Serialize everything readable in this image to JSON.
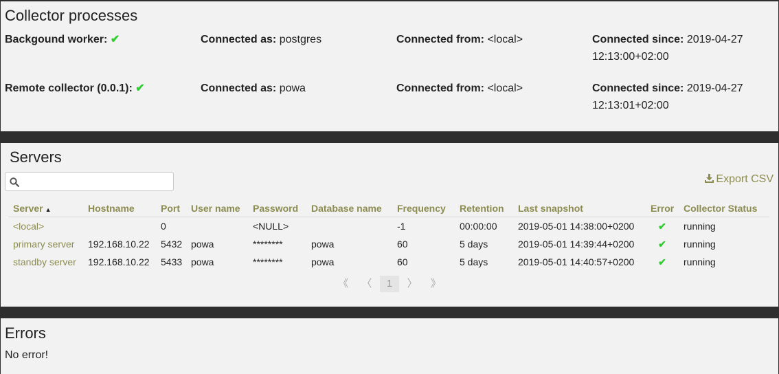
{
  "collector": {
    "title": "Collector processes",
    "rows": [
      {
        "name_label": "Backgound worker:",
        "connected_as_label": "Connected as:",
        "connected_as": "postgres",
        "connected_from_label": "Connected from:",
        "connected_from": "<local>",
        "connected_since_label": "Connected since:",
        "connected_since_date": "2019-04-27",
        "connected_since_time": "12:13:00+02:00"
      },
      {
        "name_label": "Remote collector (0.0.1):",
        "connected_as_label": "Connected as:",
        "connected_as": "powa",
        "connected_from_label": "Connected from:",
        "connected_from": "<local>",
        "connected_since_label": "Connected since:",
        "connected_since_date": "2019-04-27",
        "connected_since_time": "12:13:01+02:00"
      }
    ],
    "check_glyph": "✔"
  },
  "servers": {
    "title": "Servers",
    "search": {
      "placeholder": "",
      "value": ""
    },
    "export_label": "Export CSV",
    "columns": [
      "Server",
      "Hostname",
      "Port",
      "User name",
      "Password",
      "Database name",
      "Frequency",
      "Retention",
      "Last snapshot",
      "Error",
      "Collector Status"
    ],
    "sorted_column": "Server",
    "rows": [
      {
        "server": "<local>",
        "hostname": "",
        "port": "0",
        "username": "",
        "password": "<NULL>",
        "database": "",
        "frequency": "-1",
        "retention": "00:00:00",
        "last_snapshot": "2019-05-01 14:38:00+0200",
        "error": "✔",
        "status": "running"
      },
      {
        "server": "primary server",
        "hostname": "192.168.10.22",
        "port": "5432",
        "username": "powa",
        "password": "********",
        "database": "powa",
        "frequency": "60",
        "retention": "5 days",
        "last_snapshot": "2019-05-01 14:39:44+0200",
        "error": "✔",
        "status": "running"
      },
      {
        "server": "standby server",
        "hostname": "192.168.10.22",
        "port": "5433",
        "username": "powa",
        "password": "********",
        "database": "powa",
        "frequency": "60",
        "retention": "5 days",
        "last_snapshot": "2019-05-01 14:40:57+0200",
        "error": "✔",
        "status": "running"
      }
    ],
    "pager": {
      "first": "《",
      "prev": "〈",
      "current": "1",
      "next": "〉",
      "last": "》"
    }
  },
  "errors": {
    "title": "Errors",
    "message": "No error!"
  },
  "colors": {
    "accent": "#8c8c50",
    "check": "#2ecc2e",
    "divider": "#2e2e2e"
  }
}
